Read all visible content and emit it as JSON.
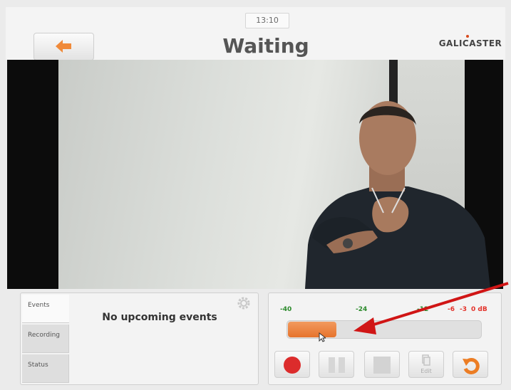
{
  "header": {
    "clock": "13:10",
    "title": "Waiting",
    "logo": "GALICASTER",
    "back_icon": "arrow-left-icon"
  },
  "events_panel": {
    "tabs": [
      {
        "label": "Events",
        "active": true
      },
      {
        "label": "Recording",
        "active": false
      },
      {
        "label": "Status",
        "active": false
      }
    ],
    "message": "No upcoming events",
    "settings_icon": "gear-icon"
  },
  "audio_meter": {
    "scale": [
      {
        "label": "-40",
        "color": "#2b8a2b"
      },
      {
        "label": "-24",
        "color": "#2b8a2b"
      },
      {
        "label": "-12",
        "color": "#2b8a2b"
      },
      {
        "label": "-6",
        "color": "#e3322a"
      },
      {
        "label": "-3",
        "color": "#e3322a"
      },
      {
        "label": "0 dB",
        "color": "#e3322a"
      }
    ],
    "level_fraction": 0.25,
    "fill_color": "#e6732c"
  },
  "controls": {
    "record_icon": "record-icon",
    "pause_icon": "pause-icon",
    "stop_icon": "stop-icon",
    "edit_label": "Edit",
    "reset_icon": "rotate-back-icon"
  },
  "annotation": {
    "color": "#d01515"
  }
}
